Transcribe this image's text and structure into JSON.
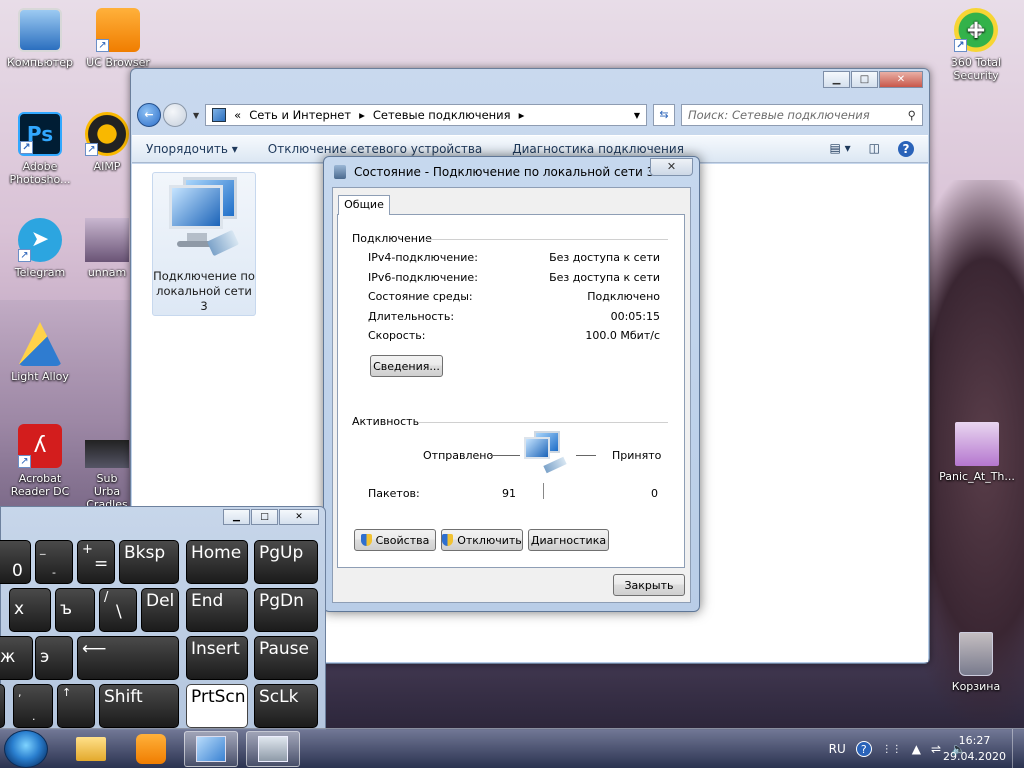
{
  "desktop": {
    "icons_left": [
      {
        "label": "Компьютер",
        "icon": "computer-icon"
      },
      {
        "label": "UC Browser",
        "icon": "uc-browser-icon"
      },
      {
        "label": "Adobe Photosho...",
        "icon": "photoshop-icon"
      },
      {
        "label": "AIMP",
        "icon": "aimp-icon"
      },
      {
        "label": "Telegram",
        "icon": "telegram-icon"
      },
      {
        "label": "unnam",
        "icon": "image-thumb-icon"
      },
      {
        "label": "Light Alloy",
        "icon": "light-alloy-icon"
      },
      {
        "label": "Acrobat Reader DC",
        "icon": "acrobat-icon"
      },
      {
        "label": "Sub Urba Cradles",
        "icon": "video-thumb-icon"
      }
    ],
    "icons_right": [
      {
        "label": "360 Total Security",
        "icon": "360-security-icon"
      },
      {
        "label": "Panic_At_Th...",
        "icon": "audio-file-icon"
      },
      {
        "label": "Корзина",
        "icon": "recycle-bin-icon"
      }
    ]
  },
  "explorer": {
    "breadcrumb_prefix": "«",
    "breadcrumb": [
      "Сеть и Интернет",
      "Сетевые подключения"
    ],
    "search_placeholder": "Поиск: Сетевые подключения",
    "toolbar": {
      "organize": "Упорядочить",
      "disable": "Отключение сетевого устройства",
      "diagnose": "Диагностика подключения"
    },
    "connection_item": {
      "label": "Подключение по локальной сети 3"
    }
  },
  "dialog": {
    "title": "Состояние - Подключение по локальной сети 3",
    "tab": "Общие",
    "connection_group": "Подключение",
    "rows": [
      {
        "label": "IPv4-подключение:",
        "value": "Без доступа к сети"
      },
      {
        "label": "IPv6-подключение:",
        "value": "Без доступа к сети"
      },
      {
        "label": "Состояние среды:",
        "value": "Подключено"
      },
      {
        "label": "Длительность:",
        "value": "00:05:15"
      },
      {
        "label": "Скорость:",
        "value": "100.0 Мбит/с"
      }
    ],
    "details_button": "Сведения...",
    "activity_group": "Активность",
    "sent_label": "Отправлено",
    "received_label": "Принято",
    "packets_label": "Пакетов:",
    "packets_sent": "91",
    "packets_received": "0",
    "properties_button": "Свойства",
    "disable_button": "Отключить",
    "diagnose_button": "Диагностика",
    "close_button": "Закрыть"
  },
  "keyboard": {
    "keys": [
      {
        "main": "0"
      },
      {
        "top": "_",
        "main": "-"
      },
      {
        "top": "+",
        "main": "="
      },
      {
        "main": "Bksp"
      },
      {
        "main": "Home"
      },
      {
        "main": "PgUp"
      },
      {
        "main": "х"
      },
      {
        "main": "ъ"
      },
      {
        "top": "/",
        "main": "\\"
      },
      {
        "main": "Del"
      },
      {
        "main": "End"
      },
      {
        "main": "PgDn"
      },
      {
        "main": "ж"
      },
      {
        "main": "э"
      },
      {
        "main": "Insert"
      },
      {
        "main": "Pause"
      },
      {
        "top": ",",
        "main": "."
      },
      {
        "main": "↑"
      },
      {
        "main": "Shift"
      },
      {
        "main": "PrtScn"
      },
      {
        "main": "ScLk"
      }
    ]
  },
  "taskbar": {
    "lang": "RU",
    "time": "16:27",
    "date": "29.04.2020"
  },
  "colors": {
    "accent": "#2c6dc8",
    "window_frame": "#c6d8ee"
  }
}
